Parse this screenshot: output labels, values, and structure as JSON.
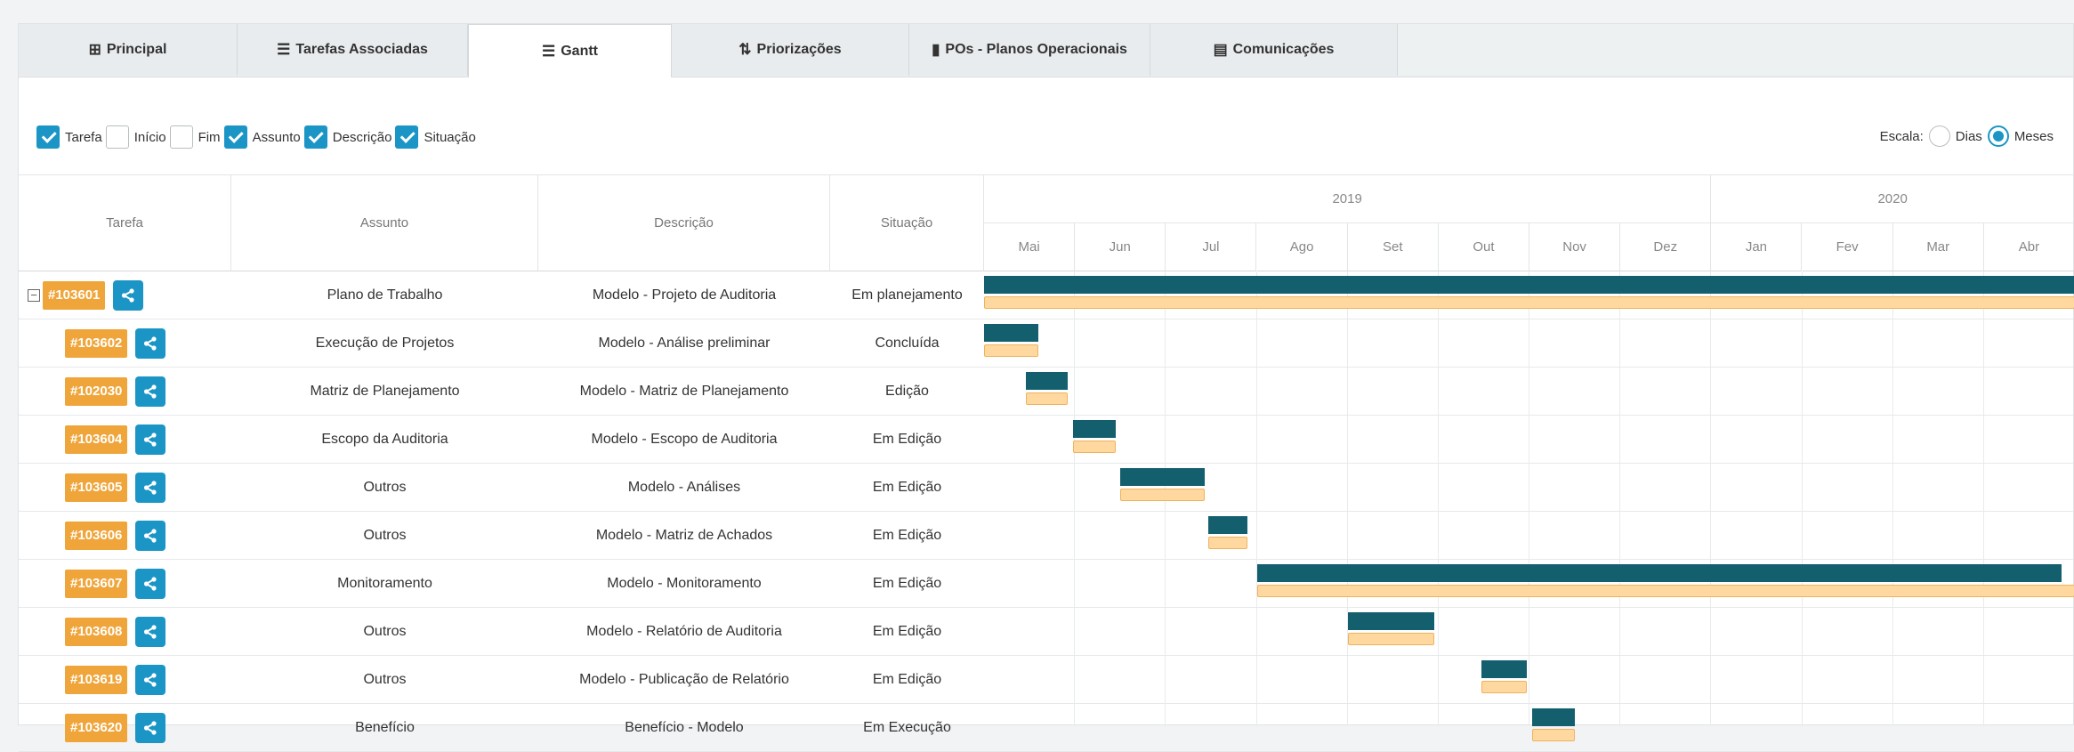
{
  "tabs": [
    {
      "label": "Principal",
      "icon": "table-icon",
      "glyph": "⊞"
    },
    {
      "label": "Tarefas Associadas",
      "icon": "task-list-icon",
      "glyph": "☰"
    },
    {
      "label": "Gantt",
      "icon": "gantt-list-icon",
      "glyph": "☰"
    },
    {
      "label": "Priorizações",
      "icon": "sort-icon",
      "glyph": "⇅"
    },
    {
      "label": "POs - Planos Operacionais",
      "icon": "clipboard-icon",
      "glyph": "▮"
    },
    {
      "label": "Comunicações",
      "icon": "message-icon",
      "glyph": "▤"
    }
  ],
  "active_tab": "Gantt",
  "toolbar": {
    "columns": [
      {
        "label": "Tarefa",
        "checked": true
      },
      {
        "label": "Início",
        "checked": false
      },
      {
        "label": "Fim",
        "checked": false
      },
      {
        "label": "Assunto",
        "checked": true
      },
      {
        "label": "Descrição",
        "checked": true
      },
      {
        "label": "Situação",
        "checked": true
      }
    ],
    "scale_label": "Escala:",
    "scale_options": [
      {
        "label": "Dias",
        "selected": false
      },
      {
        "label": "Meses",
        "selected": true
      }
    ]
  },
  "table": {
    "headers": {
      "tarefa": "Tarefa",
      "assunto": "Assunto",
      "descricao": "Descrição",
      "situacao": "Situação"
    },
    "years": [
      "2019",
      "2020"
    ],
    "months": [
      "Mai",
      "Jun",
      "Jul",
      "Ago",
      "Set",
      "Out",
      "Nov",
      "Dez",
      "Jan",
      "Fev",
      "Mar",
      "Abr"
    ],
    "rows": [
      {
        "id": "#103601",
        "parent": true,
        "assunto": "Plano de Trabalho",
        "descricao": "Modelo - Projeto de Auditoria",
        "situacao": "Em planejamento",
        "start": 0,
        "end": 12,
        "base_start": 0,
        "base_end": 12
      },
      {
        "id": "#103602",
        "parent": false,
        "assunto": "Execução de Projetos",
        "descricao": "Modelo - Análise preliminar",
        "situacao": "Concluída",
        "start": 0,
        "end": 0.6,
        "base_start": 0,
        "base_end": 0.6
      },
      {
        "id": "#102030",
        "parent": false,
        "assunto": "Matriz de Planejamento",
        "descricao": "Modelo - Matriz de Planejamento",
        "situacao": "Edição",
        "start": 0.46,
        "end": 0.92,
        "base_start": 0.46,
        "base_end": 0.92
      },
      {
        "id": "#103604",
        "parent": false,
        "assunto": "Escopo da Auditoria",
        "descricao": "Modelo - Escopo de Auditoria",
        "situacao": "Em Edição",
        "start": 0.98,
        "end": 1.45,
        "base_start": 0.98,
        "base_end": 1.45
      },
      {
        "id": "#103605",
        "parent": false,
        "assunto": "Outros",
        "descricao": "Modelo - Análises",
        "situacao": "Em Edição",
        "start": 1.5,
        "end": 2.43,
        "base_start": 1.5,
        "base_end": 2.43
      },
      {
        "id": "#103606",
        "parent": false,
        "assunto": "Outros",
        "descricao": "Modelo - Matriz de Achados",
        "situacao": "Em Edição",
        "start": 2.47,
        "end": 2.9,
        "base_start": 2.47,
        "base_end": 2.9
      },
      {
        "id": "#103607",
        "parent": false,
        "assunto": "Monitoramento",
        "descricao": "Modelo - Monitoramento",
        "situacao": "Em Edição",
        "start": 3.0,
        "end": 11.85,
        "base_start": 3.0,
        "base_end": 12
      },
      {
        "id": "#103608",
        "parent": false,
        "assunto": "Outros",
        "descricao": "Modelo - Relatório de Auditoria",
        "situacao": "Em Edição",
        "start": 4.0,
        "end": 4.95,
        "base_start": 4.0,
        "base_end": 4.95
      },
      {
        "id": "#103619",
        "parent": false,
        "assunto": "Outros",
        "descricao": "Modelo - Publicação de Relatório",
        "situacao": "Em Edição",
        "start": 5.47,
        "end": 5.97,
        "base_start": 5.47,
        "base_end": 5.97
      },
      {
        "id": "#103620",
        "parent": false,
        "assunto": "Benefício",
        "descricao": "Benefício - Modelo",
        "situacao": "Em Execução",
        "start": 6.03,
        "end": 6.5,
        "base_start": 6.03,
        "base_end": 6.5
      }
    ]
  }
}
